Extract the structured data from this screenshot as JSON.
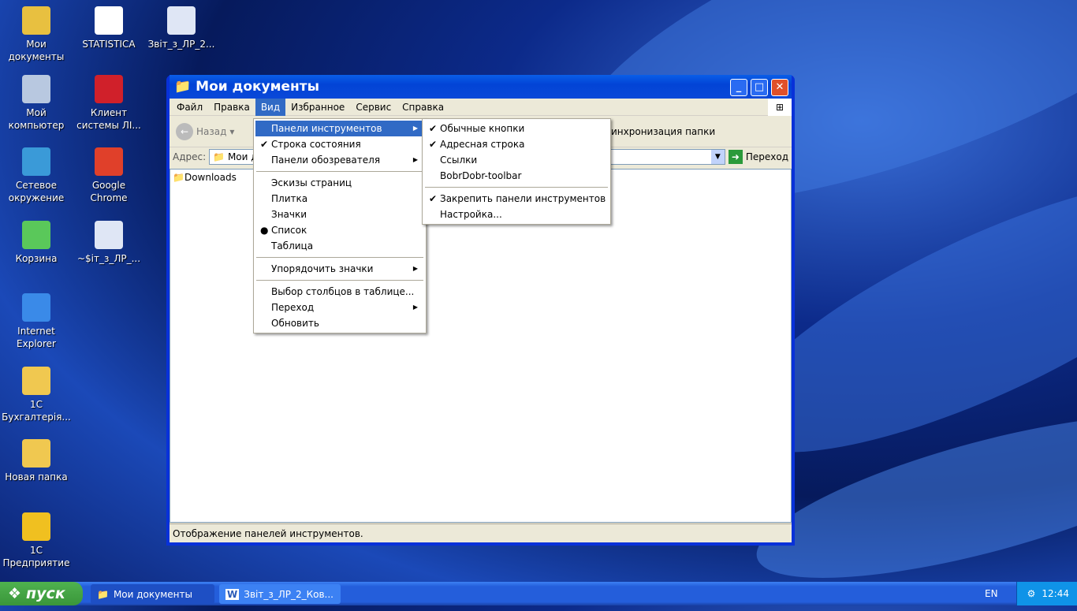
{
  "desktop": {
    "icons": [
      {
        "label": "Мои документы",
        "icon": "my-documents-icon"
      },
      {
        "label": "STATISTICA",
        "icon": "statistica-icon"
      },
      {
        "label": "Звіт_з_ЛР_2...",
        "icon": "word-document-icon"
      },
      {
        "label": "Мой компьютер",
        "icon": "my-computer-icon"
      },
      {
        "label": "Клиент системы ЛІ...",
        "icon": "client-app-icon"
      },
      {
        "label": "Сетевое окружение",
        "icon": "network-icon"
      },
      {
        "label": "Google Chrome",
        "icon": "chrome-icon"
      },
      {
        "label": "Корзина",
        "icon": "recycle-bin-icon"
      },
      {
        "label": "~$іт_з_ЛР_...",
        "icon": "word-document-icon"
      },
      {
        "label": "Internet Explorer",
        "icon": "internet-explorer-icon"
      },
      {
        "label": "1С Бухгалтерія...",
        "icon": "folder-icon"
      },
      {
        "label": "Новая папка",
        "icon": "folder-icon"
      },
      {
        "label": "1С Предприятие",
        "icon": "1c-icon"
      }
    ]
  },
  "window": {
    "title": "Мои документы",
    "menubar": [
      "Файл",
      "Правка",
      "Вид",
      "Избранное",
      "Сервис",
      "Справка"
    ],
    "toolbar": {
      "back": "Назад",
      "sync": "инхронизация папки"
    },
    "address": {
      "label": "Адрес:",
      "value": "Мои д",
      "go": "Переход"
    },
    "files": [
      "Downloads"
    ],
    "status": "Отображение панелей инструментов."
  },
  "view_menu": {
    "items": [
      {
        "label": "Панели инструментов",
        "submenu": true,
        "highlighted": true
      },
      {
        "label": "Строка состояния",
        "check": "✔"
      },
      {
        "label": "Панели обозревателя",
        "submenu": true
      },
      {
        "sep": true
      },
      {
        "label": "Эскизы страниц"
      },
      {
        "label": "Плитка"
      },
      {
        "label": "Значки"
      },
      {
        "label": "Список",
        "check": "●"
      },
      {
        "label": "Таблица"
      },
      {
        "sep": true
      },
      {
        "label": "Упорядочить значки",
        "submenu": true
      },
      {
        "sep": true
      },
      {
        "label": "Выбор столбцов в таблице..."
      },
      {
        "label": "Переход",
        "submenu": true
      },
      {
        "label": "Обновить"
      }
    ]
  },
  "toolbars_submenu": {
    "items": [
      {
        "label": "Обычные кнопки",
        "check": "✔"
      },
      {
        "label": "Адресная строка",
        "check": "✔"
      },
      {
        "label": "Ссылки"
      },
      {
        "label": "BobrDobr-toolbar"
      },
      {
        "sep": true
      },
      {
        "label": "Закрепить панели инструментов",
        "check": "✔"
      },
      {
        "label": "Настройка..."
      }
    ]
  },
  "taskbar": {
    "start": "пуск",
    "buttons": [
      "Мои документы",
      "Звіт_з_ЛР_2_Ков..."
    ],
    "lang": "EN",
    "clock": "12:44"
  }
}
